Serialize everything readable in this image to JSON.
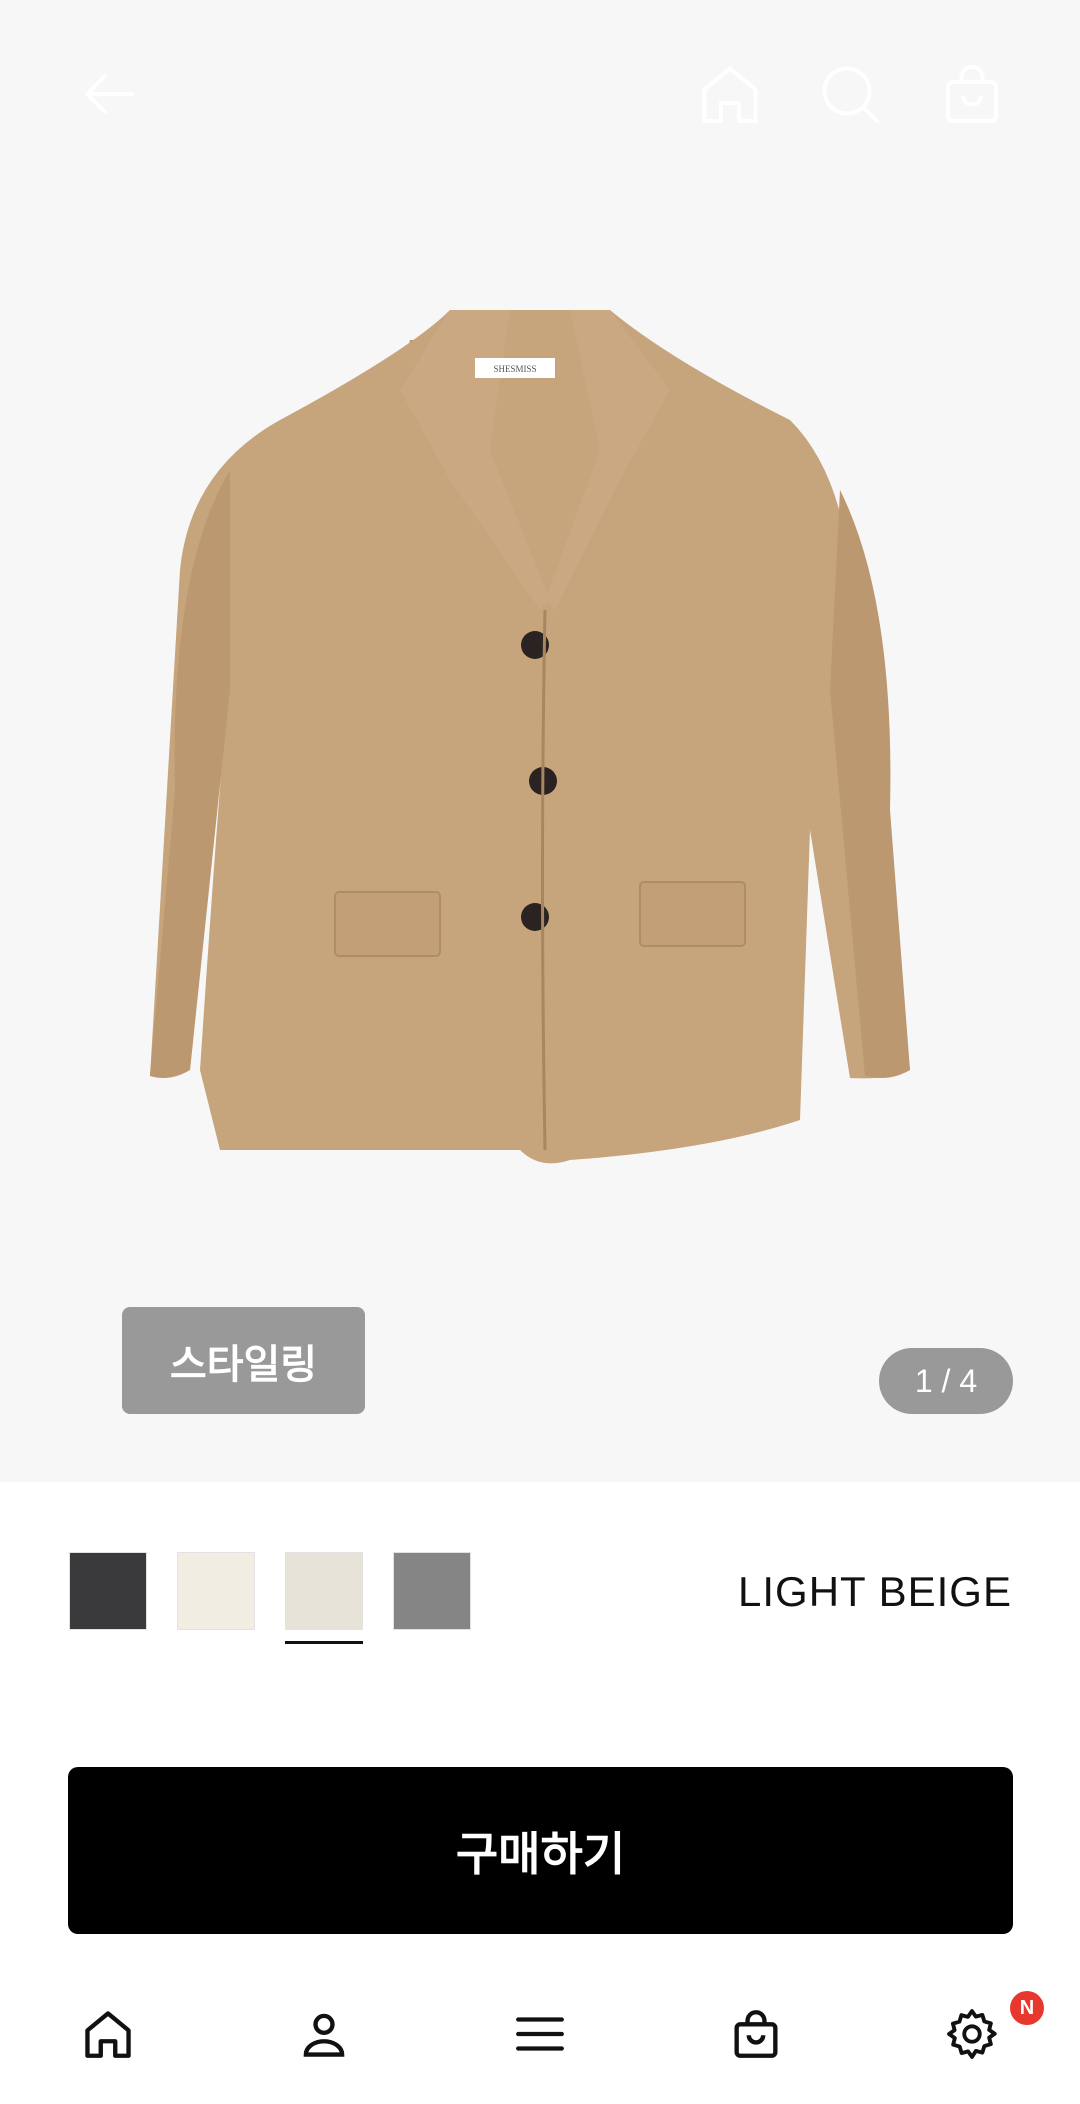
{
  "header": {
    "back_icon": "arrow-left-icon",
    "home_icon": "home-icon",
    "search_icon": "search-icon",
    "cart_icon": "shopping-bag-icon"
  },
  "product": {
    "image": "beige-wool-jacket",
    "label_text": "SHESMISS",
    "styling_label": "스타일링",
    "page_indicator": "1 / 4"
  },
  "colors": {
    "swatches": [
      "#3a393c",
      "#f2ede2",
      "#e8e3d8",
      "#858585"
    ],
    "selected_index": 2,
    "selected_name": "LIGHT BEIGE"
  },
  "buy": {
    "label": "구매하기"
  },
  "bottom_nav": {
    "items": [
      "home-icon",
      "user-icon",
      "menu-icon",
      "shopping-bag-icon",
      "gear-icon"
    ],
    "settings_badge": "N"
  }
}
